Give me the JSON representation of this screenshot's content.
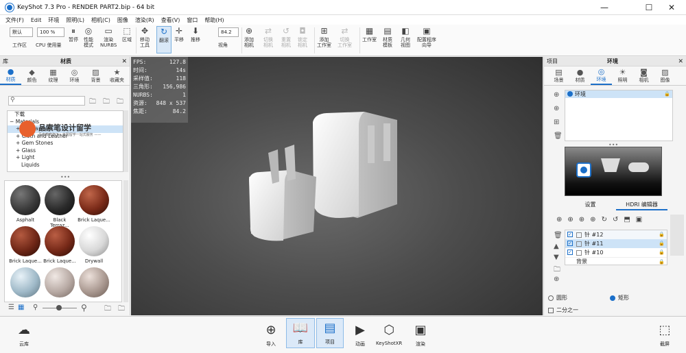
{
  "window": {
    "title": "KeyShot 7.3 Pro  - RENDER PART2.bip  - 64 bit",
    "minimize": "—",
    "maximize": "☐",
    "close": "✕"
  },
  "menu": [
    "文件(F)",
    "Edit",
    "环境",
    "照明(L)",
    "相机(C)",
    "图像",
    "渲染(R)",
    "查看(V)",
    "窗口",
    "帮助(H)"
  ],
  "toolbar": {
    "workspace_select": "默认",
    "zoom_select": "100 %",
    "fov_value": "84.2",
    "buttons": [
      {
        "id": "workspace",
        "label": "工作区",
        "icon": "select"
      },
      {
        "id": "cpu",
        "label": "CPU 使用量",
        "icon": "zoom"
      },
      {
        "id": "pause",
        "label": "暂停",
        "icon": "⏸"
      },
      {
        "id": "perf",
        "label": "性能\n模式",
        "icon": "◎"
      },
      {
        "id": "nurbs",
        "label": "渲染\nNURBS",
        "icon": "▭"
      },
      {
        "id": "region",
        "label": "区域",
        "icon": "⬚"
      },
      {
        "id": "move",
        "label": "移动\n工具",
        "icon": "✥"
      },
      {
        "id": "tumble",
        "label": "翻滚",
        "icon": "↻"
      },
      {
        "id": "pan",
        "label": "平移",
        "icon": "✛"
      },
      {
        "id": "dolly",
        "label": "推移",
        "icon": "⬇"
      },
      {
        "id": "fov",
        "label": "视角",
        "icon": "fov"
      },
      {
        "id": "addcam",
        "label": "添加\n相机",
        "icon": "📷"
      },
      {
        "id": "switchcam",
        "label": "切换\n相机",
        "icon": "📷"
      },
      {
        "id": "resetcam",
        "label": "重置\n相机",
        "icon": "↺"
      },
      {
        "id": "lockcam",
        "label": "锁定\n相机",
        "icon": "🔒"
      },
      {
        "id": "addstudio",
        "label": "添加\n工作室",
        "icon": "+"
      },
      {
        "id": "switchstudio",
        "label": "切换\n工作室",
        "icon": "⇄"
      },
      {
        "id": "studio",
        "label": "工作室",
        "icon": "▦"
      },
      {
        "id": "mattemplate",
        "label": "材质\n模板",
        "icon": "▤"
      },
      {
        "id": "geoview",
        "label": "几何\n视图",
        "icon": "◧"
      },
      {
        "id": "wizard",
        "label": "配置程序\n向导",
        "icon": "▣"
      }
    ]
  },
  "left_panel": {
    "header": "库",
    "title": "材质",
    "tabs": [
      {
        "label": "材质",
        "icon": "●"
      },
      {
        "label": "颜色",
        "icon": "◆"
      },
      {
        "label": "纹理",
        "icon": "▦"
      },
      {
        "label": "环境",
        "icon": "◎"
      },
      {
        "label": "背景",
        "icon": "▨"
      },
      {
        "label": "收藏夹",
        "icon": "★"
      }
    ],
    "search_placeholder": "",
    "tree": [
      {
        "label": "下载",
        "indent": 1,
        "expander": ""
      },
      {
        "label": "Materials",
        "indent": 1,
        "expander": "−"
      },
      {
        "label": "Axalta Paint",
        "indent": 2,
        "expander": "+"
      },
      {
        "label": "Cloth and Leather",
        "indent": 2,
        "expander": "+"
      },
      {
        "label": "Gem Stones",
        "indent": 2,
        "expander": "+"
      },
      {
        "label": "Glass",
        "indent": 2,
        "expander": "+"
      },
      {
        "label": "Light",
        "indent": 2,
        "expander": "+"
      },
      {
        "label": "Liquids",
        "indent": 2,
        "expander": ""
      }
    ],
    "watermark": {
      "title": "品索笔设计留学",
      "sub": "品索教育旗下 · 美国留学一站式服务 ——"
    },
    "materials": [
      {
        "label": "Asphalt",
        "color": "#3a3a3a"
      },
      {
        "label": "Black Terraz...",
        "color": "#2a2a2a"
      },
      {
        "label": "Brick Laque...",
        "color": "#7a2a18"
      },
      {
        "label": "Brick Laque...",
        "color": "#6e2616"
      },
      {
        "label": "Brick Laque...",
        "color": "#752817"
      },
      {
        "label": "Drywall",
        "color": "#d8d8d8"
      },
      {
        "label": "",
        "color": "#9fb9c8"
      },
      {
        "label": "",
        "color": "#b7a9a3"
      },
      {
        "label": "",
        "color": "#a99890"
      }
    ]
  },
  "stats": [
    {
      "k": "FPS:",
      "v": "127.8"
    },
    {
      "k": "时间:",
      "v": "14s"
    },
    {
      "k": "采样值:",
      "v": "118"
    },
    {
      "k": "三角形:",
      "v": "156,986"
    },
    {
      "k": "NURBS:",
      "v": "1"
    },
    {
      "k": "资源:",
      "v": "848 x 537"
    },
    {
      "k": "焦距:",
      "v": "84.2"
    }
  ],
  "right_panel": {
    "header": "项目",
    "title": "环境",
    "tabs": [
      {
        "label": "场景",
        "icon": "▤"
      },
      {
        "label": "材质",
        "icon": "●"
      },
      {
        "label": "环境",
        "icon": "◎"
      },
      {
        "label": "照明",
        "icon": "💡"
      },
      {
        "label": "相机",
        "icon": "📷"
      },
      {
        "label": "图像",
        "icon": "▨"
      }
    ],
    "env_list": [
      "环境"
    ],
    "subtabs": [
      "设置",
      "HDRI 编辑器"
    ],
    "pins": [
      {
        "label": "针 #12",
        "checked": true
      },
      {
        "label": "针 #11",
        "checked": true
      },
      {
        "label": "针 #10",
        "checked": true
      }
    ],
    "background_label": "背景",
    "shape_options": [
      {
        "label": "圆形",
        "selected": false
      },
      {
        "label": "矩形",
        "selected": true
      }
    ],
    "half_label": "二分之一"
  },
  "bottom": {
    "cloud": "云库",
    "import": "导入",
    "library": "库",
    "project": "项目",
    "animation": "动画",
    "keyshotxr": "KeyShotXR",
    "render": "渲染",
    "screenshot": "截屏"
  },
  "colors": {
    "accent": "#1b6fc9",
    "viewport_dark": "#2f2f2f",
    "panel": "#f4f4f4"
  }
}
